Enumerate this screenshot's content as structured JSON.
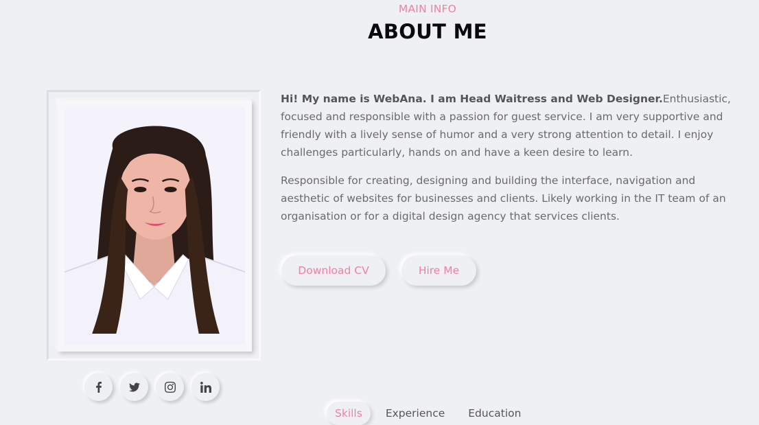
{
  "header": {
    "label": "MAIN INFO",
    "title": "ABOUT ME"
  },
  "about": {
    "intro_bold": "Hi! My name is WebAna. I am Head Waitress and Web Designer.",
    "intro_rest": "Enthusiastic, focused and responsible with a passion for guest service. I am very supportive and friendly with a lively sense of humor and a very strong attention to detail. I enjoy challenges particularly, hands on and have a keen desire to learn.",
    "paragraph2": "Responsible for creating, designing and building the interface, navigation and aesthetic of websites for businesses and clients. Likely working in the IT team of an organisation or for a digital design agency that services clients."
  },
  "buttons": {
    "download_cv": "Download CV",
    "hire_me": "Hire Me"
  },
  "social": [
    {
      "icon": "facebook-icon"
    },
    {
      "icon": "twitter-icon"
    },
    {
      "icon": "instagram-icon"
    },
    {
      "icon": "linkedin-icon"
    }
  ],
  "tabs": [
    {
      "label": "Skills",
      "active": true
    },
    {
      "label": "Experience",
      "active": false
    },
    {
      "label": "Education",
      "active": false
    }
  ],
  "colors": {
    "accent": "#f2809e",
    "background": "#eff0f4"
  }
}
